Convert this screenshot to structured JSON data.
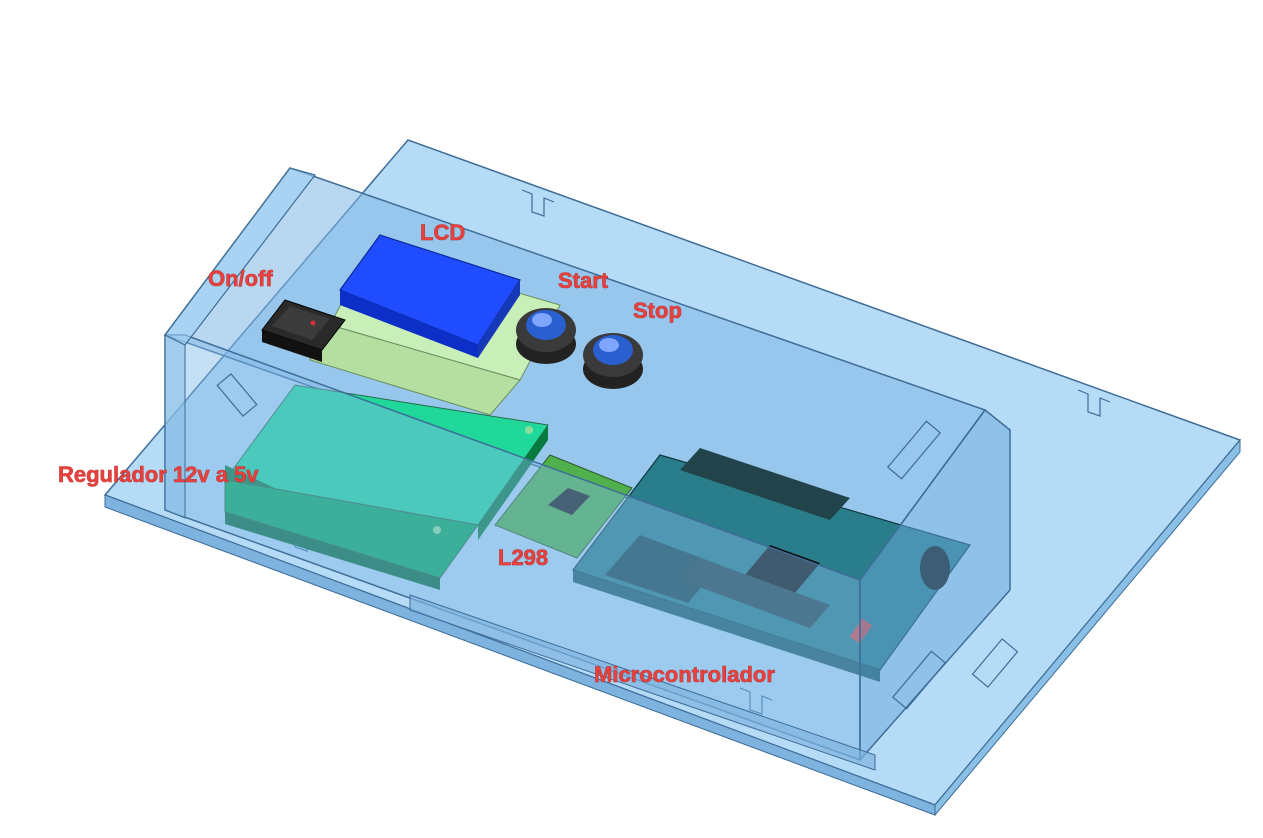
{
  "labels": {
    "lcd": "LCD",
    "on_off": "On/off",
    "start": "Start",
    "stop": "Stop",
    "regulator": "Regulador 12v a 5v",
    "l298": "L298",
    "microcontroller": "Microcontrolador"
  },
  "colors": {
    "acrylic": "#9fd0f4",
    "acrylic_edge": "#3d6d98",
    "lcd": "#1f4cff",
    "lcd_pcb": "#c9efb9",
    "regulator_board": "#05a85a",
    "l298_board": "#4fb04c",
    "microcontroller_board": "#2a7d8a",
    "button": "#2a5fd0",
    "switch": "#1e1e1e",
    "label": "#e8413d"
  }
}
